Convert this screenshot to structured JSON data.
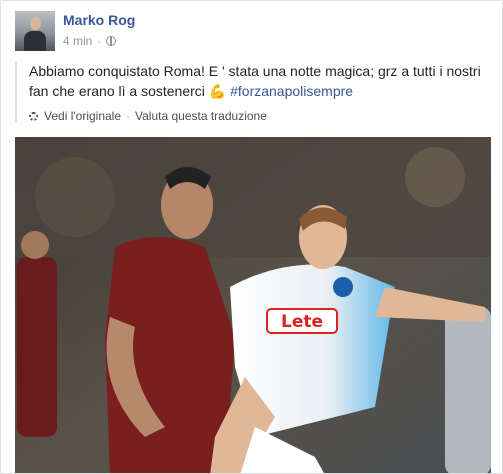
{
  "post": {
    "author_name": "Marko Rog",
    "timestamp": "4 min",
    "separator": "·",
    "privacy_icon": "globe-icon",
    "text": "Abbiamo conquistato Roma! E ' stata una notte magica; grz a tutti i nostri fan che erano lì a sostenerci",
    "emoji": "💪",
    "hashtag": "#forzanapolisempre",
    "see_original": "Vedi l'originale",
    "link_separator": "·",
    "rate_translation": "Valuta questa traduzione",
    "settings_icon": "gear-icon",
    "photo_sponsor_text": "Lete"
  },
  "colors": {
    "link_blue": "#365899",
    "meta_gray": "#90949c",
    "text_dark": "#1d2129",
    "roma_shirt": "#7a1f1f",
    "napoli_shirt": "#ffffff",
    "napoli_blue": "#5fb8e8"
  }
}
